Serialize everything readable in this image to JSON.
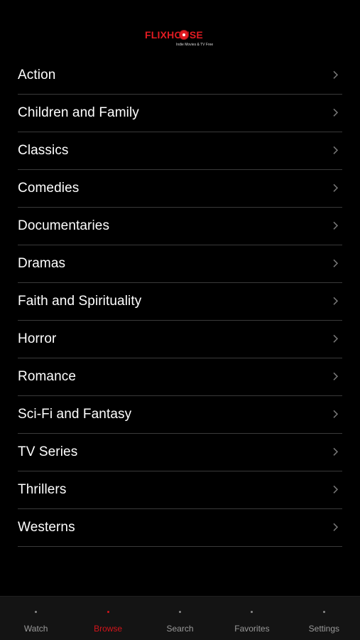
{
  "app": {
    "brand": {
      "logo_text": "FLIXHOUSE",
      "tagline": "Indie Movies & TV Free"
    },
    "colors": {
      "background": "#000000",
      "accent": "#d3141b",
      "text": "#ffffff",
      "divider": "#3a3a3a",
      "tabbar_bg": "#141414",
      "tab_inactive": "#9a9a9a"
    },
    "categories": [
      {
        "label": "Action",
        "icon": "chevron-right-icon"
      },
      {
        "label": "Children and Family",
        "icon": "chevron-right-icon"
      },
      {
        "label": "Classics",
        "icon": "chevron-right-icon"
      },
      {
        "label": "Comedies",
        "icon": "chevron-right-icon"
      },
      {
        "label": "Documentaries",
        "icon": "chevron-right-icon"
      },
      {
        "label": "Dramas",
        "icon": "chevron-right-icon"
      },
      {
        "label": "Faith and Spirituality",
        "icon": "chevron-right-icon"
      },
      {
        "label": "Horror",
        "icon": "chevron-right-icon"
      },
      {
        "label": "Romance",
        "icon": "chevron-right-icon"
      },
      {
        "label": "Sci-Fi and Fantasy",
        "icon": "chevron-right-icon"
      },
      {
        "label": "TV Series",
        "icon": "chevron-right-icon"
      },
      {
        "label": "Thrillers",
        "icon": "chevron-right-icon"
      },
      {
        "label": "Westerns",
        "icon": "chevron-right-icon"
      }
    ],
    "tabbar": {
      "active": "Browse",
      "tabs": [
        {
          "label": "Watch",
          "icon": "dot-icon"
        },
        {
          "label": "Browse",
          "icon": "dot-icon"
        },
        {
          "label": "Search",
          "icon": "dot-icon"
        },
        {
          "label": "Favorites",
          "icon": "dot-icon"
        },
        {
          "label": "Settings",
          "icon": "dot-icon"
        }
      ]
    }
  }
}
